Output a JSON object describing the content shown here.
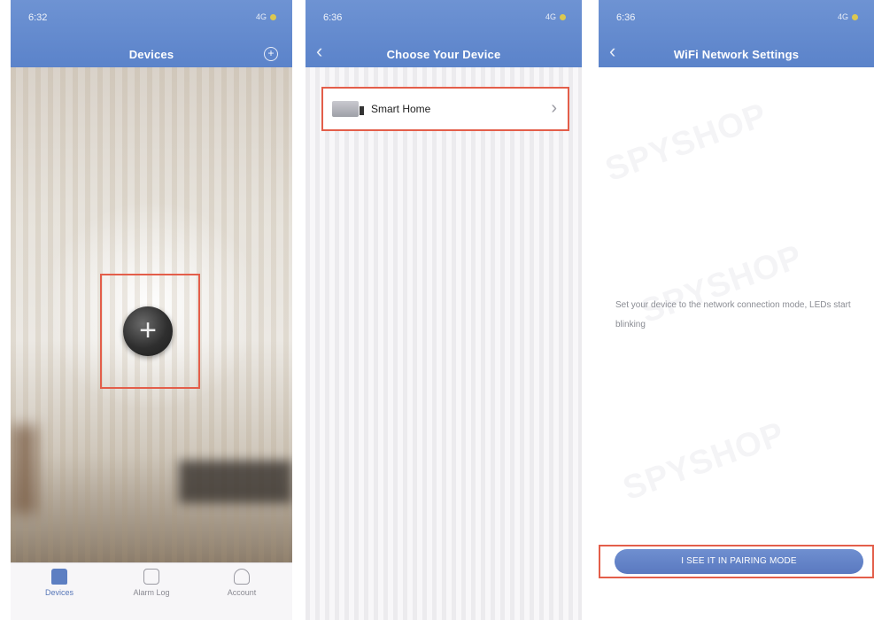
{
  "screen1": {
    "status_time": "6:32",
    "status_right": "4G",
    "title": "Devices",
    "add_icon": "plus-circle-icon",
    "plus_button_glyph": "+",
    "tabs": [
      {
        "label": "Devices",
        "icon": "home-icon"
      },
      {
        "label": "Alarm Log",
        "icon": "chat-icon"
      },
      {
        "label": "Account",
        "icon": "person-icon"
      }
    ],
    "highlight_color": "#e35e4a"
  },
  "screen2": {
    "status_time": "6:36",
    "status_right": "4G",
    "title": "Choose Your Device",
    "back_glyph": "‹",
    "item": {
      "label": "Smart Home",
      "icon": "router-icon",
      "chevron": "›"
    }
  },
  "screen3": {
    "status_time": "6:36",
    "status_right": "4G",
    "title": "WiFi Network Settings",
    "back_glyph": "‹",
    "instruction": "Set your device to the network connection mode, LEDs start blinking",
    "button_label": "I SEE IT IN PAIRING MODE"
  },
  "watermark": "SPYSHOP",
  "colors": {
    "header": "#5b83ca",
    "accent": "#5d7fc2",
    "highlight": "#e35e4a"
  }
}
